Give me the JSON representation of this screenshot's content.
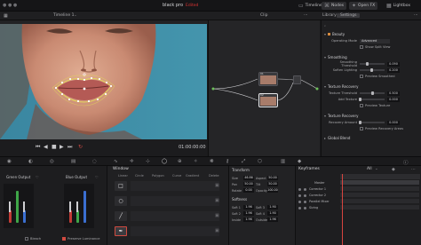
{
  "app": {
    "title": "black pro",
    "status": "Edited"
  },
  "toptabs": {
    "timeline": "Timeline",
    "nodes": "Nodes",
    "openfx": "Open FX",
    "lightbox": "Lightbox"
  },
  "subbar": {
    "timeline_name": "Timeline 1",
    "clip": "Clip",
    "library": "Library",
    "settings": "Settings"
  },
  "viewer": {
    "timecode": "01:00:00:00"
  },
  "settings_panel": {
    "search_placeholder": "",
    "beauty": "Beauty",
    "operating_mode_label": "Operating Mode",
    "operating_mode_value": "Advanced",
    "show_split_view": "Show Split View",
    "smoothing": "Smoothing",
    "smoothing_threshold_label": "Smoothing Threshold",
    "smoothing_threshold_value": "0.090",
    "smoothing_threshold_level": 0.3,
    "soften_lighting_label": "Soften Lighting",
    "soften_lighting_value": "0.200",
    "soften_lighting_level": 0.45,
    "preview_smoothed": "Preview Smoothed",
    "texture_recovery": "Texture Recovery",
    "texture_threshold_label": "Texture Threshold",
    "texture_threshold_value": "0.500",
    "texture_threshold_level": 0.5,
    "add_texture_label": "Add Texture",
    "add_texture_value": "0.000",
    "add_texture_level": 0.0,
    "preview_texture": "Preview Texture",
    "texture_recovery_2": "Texture Recovery",
    "recovery_amount_label": "Recovery Amount",
    "recovery_amount_value": "0.000",
    "recovery_amount_level": 0.0,
    "preview_recovery_areas": "Preview Recovery Areas",
    "global_blend": "Global Blend"
  },
  "scopes": {
    "green_output": "Green Output",
    "blue_output": "Blue Output",
    "bleach": "Bleach",
    "preserve_luminance": "Preserve Luminance"
  },
  "window_panel": {
    "title": "Window",
    "tabs": [
      "Linear",
      "Circle",
      "Polygon",
      "Curve",
      "Gradient",
      "Delete"
    ]
  },
  "transform": {
    "title": "Transform",
    "size_label": "Size",
    "size_value": "46.86",
    "aspect_label": "Aspect",
    "aspect_value": "50.00",
    "pan_label": "Pan",
    "pan_value": "50.00",
    "tilt_label": "Tilt",
    "tilt_value": "50.00",
    "rotate_label": "Rotate",
    "rotate_value": "0.00",
    "opacity_label": "Opacity",
    "opacity_value": "100.00",
    "softness_title": "Softness",
    "soft1_label": "Soft 1",
    "soft1_value": "1.96",
    "soft3_label": "Soft 3",
    "soft3_value": "1.90",
    "soft2_label": "Soft 2",
    "soft2_value": "1.96",
    "soft4_label": "Soft 4",
    "soft4_value": "1.90",
    "inside_label": "Inside",
    "inside_value": "1.96",
    "outside_label": "Outside",
    "outside_value": "1.96"
  },
  "keyframes": {
    "title": "Keyframes",
    "filter": "All",
    "rows": [
      "Master",
      "Corrector 1",
      "Corrector 2",
      "Parallel Mixer",
      "Sizing"
    ]
  }
}
